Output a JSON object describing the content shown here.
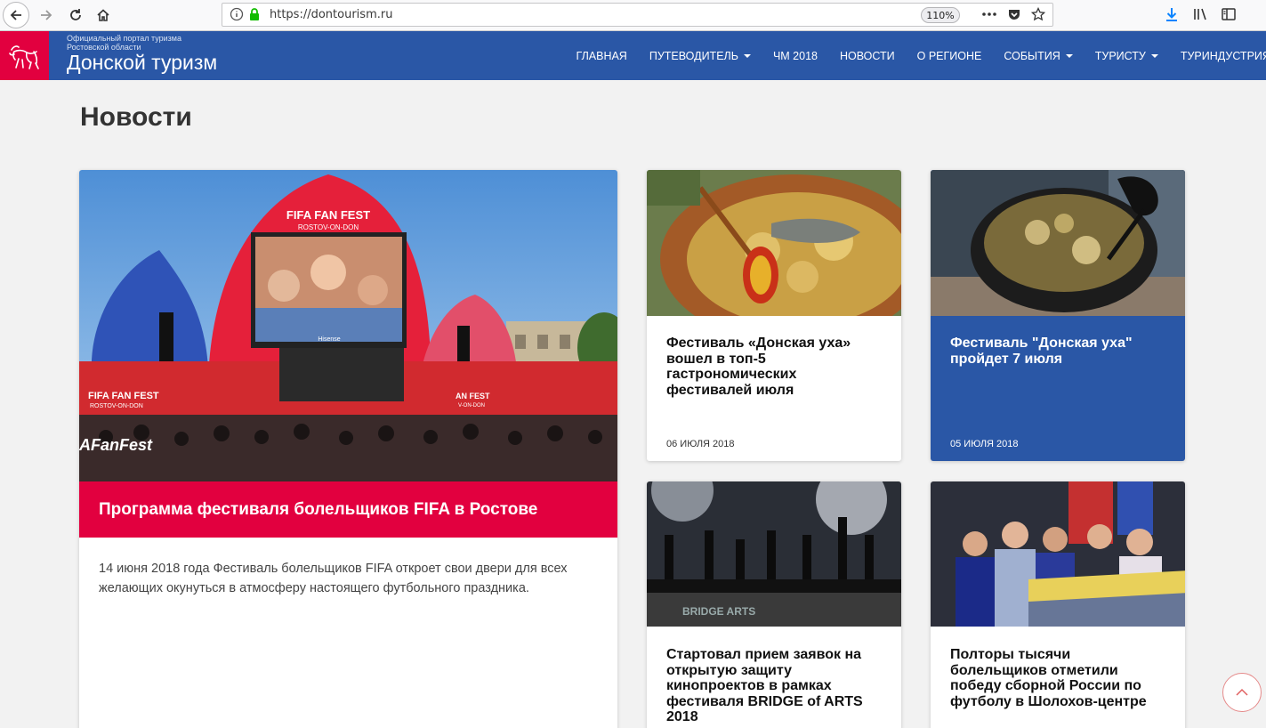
{
  "browser": {
    "url": "https://dontourism.ru",
    "zoom": "110%"
  },
  "site": {
    "tagline_line1": "Официальный портал туризма",
    "tagline_line2": "Ростовской области",
    "title": "Донской туризм"
  },
  "nav": [
    {
      "label": "ГЛАВНАЯ",
      "dropdown": false
    },
    {
      "label": "ПУТЕВОДИТЕЛЬ",
      "dropdown": true
    },
    {
      "label": "ЧМ 2018",
      "dropdown": false
    },
    {
      "label": "НОВОСТИ",
      "dropdown": false
    },
    {
      "label": "О РЕГИОНЕ",
      "dropdown": false
    },
    {
      "label": "СОБЫТИЯ",
      "dropdown": true
    },
    {
      "label": "ТУРИСТУ",
      "dropdown": true
    },
    {
      "label": "ТУРИНДУСТРИЯ",
      "dropdown": true
    }
  ],
  "page": {
    "heading": "Новости"
  },
  "featured": {
    "title": "Программа фестиваля болельщиков FIFA в Ростове",
    "text": "14 июня 2018 года Фестиваль болельщиков FIFA откроет свои двери для всех желающих окунуться в атмосферу настоящего футбольного праздника.",
    "image_labels": {
      "dome": "FIFA FAN FEST",
      "dome_sub": "ROSTOV-ON-DON",
      "screen_brand": "Hisense",
      "stage_left": "FIFA FAN FEST",
      "stage_left_sub": "ROSTOV-ON-DON",
      "stage_right": "AN FEST",
      "stage_right_sub": "V-ON-DON",
      "banner": "AFanFest"
    }
  },
  "news": [
    {
      "title": "Фестиваль «Донская уха» вошел в топ-5 гастрономических фестивалей июля",
      "date": "06 ИЮЛЯ 2018"
    },
    {
      "title": "Фестиваль \"Донская уха\" пройдет 7 июля",
      "date": "05 ИЮЛЯ 2018"
    },
    {
      "title": "Стартовал прием заявок на открытую защиту кинопроектов в рамках фестиваля BRIDGE of ARTS 2018",
      "date": "",
      "image_label": "BRIDGE ARTS"
    },
    {
      "title": "Полторы тысячи болельщиков отметили победу сборной России по футболу в Шолохов-центре",
      "date": ""
    }
  ],
  "colors": {
    "header_blue": "#2a57a6",
    "brand_red": "#e2003f"
  }
}
